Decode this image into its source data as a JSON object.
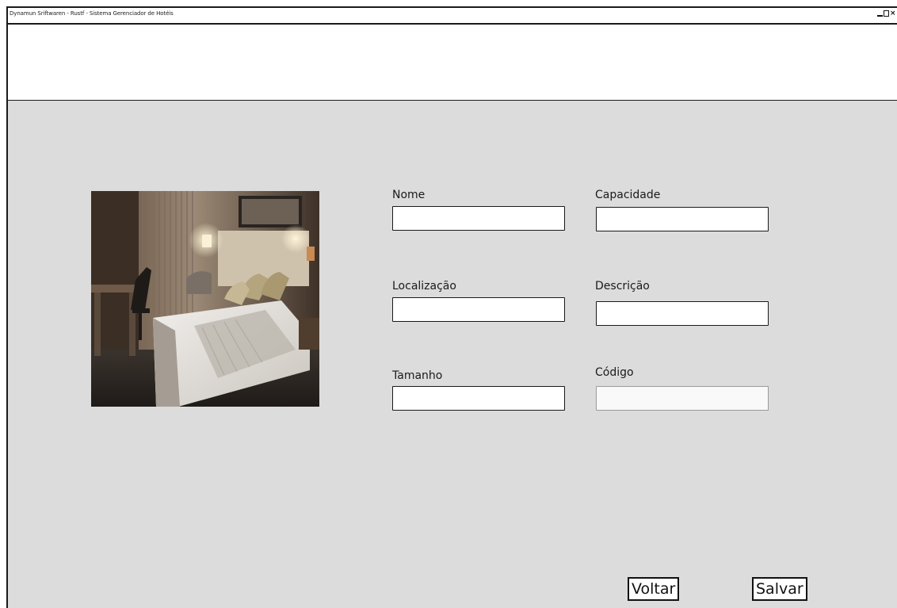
{
  "window": {
    "title": "Dynamun Sriftwaren - Rustf - Sistema Gerenciador de Hotéis",
    "controls": {
      "minimize": "minimize-icon",
      "maximize": "maximize-icon",
      "close": "×"
    }
  },
  "form": {
    "photo": "hotel-room-photo",
    "fields": {
      "nome": {
        "label": "Nome",
        "value": "",
        "placeholder": ""
      },
      "capacidade": {
        "label": "Capacidade",
        "value": "",
        "placeholder": ""
      },
      "localizacao": {
        "label": "Localização",
        "value": "",
        "placeholder": ""
      },
      "descricao": {
        "label": "Descrição",
        "value": "",
        "placeholder": ""
      },
      "tamanho": {
        "label": "Tamanho",
        "value": "",
        "placeholder": ""
      },
      "codigo": {
        "label": "Código",
        "value": "",
        "placeholder": ""
      }
    }
  },
  "actions": {
    "voltar": "Voltar",
    "salvar": "Salvar"
  },
  "colors": {
    "background": "#dcdcdc",
    "border": "#1a1a1a",
    "input_bg": "#ffffff"
  }
}
